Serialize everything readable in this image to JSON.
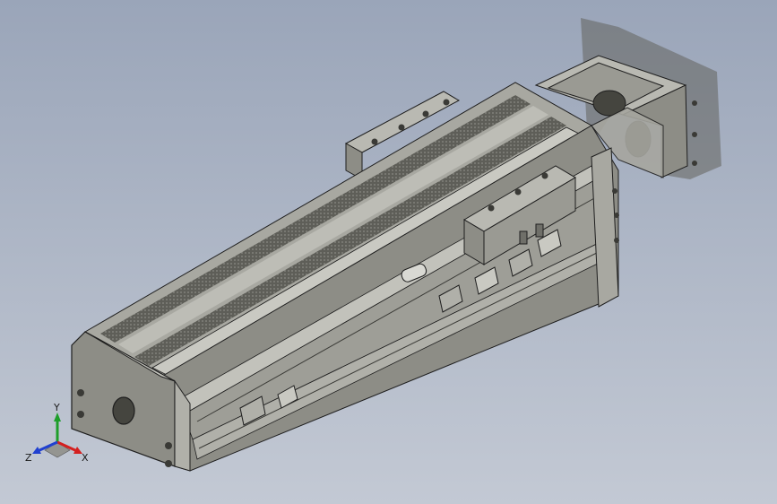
{
  "viewport": {
    "background_top": "#9aa5b9",
    "background_bottom": "#c3c9d4",
    "model_color": "#9a9a93",
    "model_dark": "#6f6f69",
    "model_light": "#b9b9b2",
    "edge_color": "#1e1e1e"
  },
  "model": {
    "name": "linear-actuator-module",
    "icons": [
      "motor-bracket-icon",
      "carriage-icon",
      "sensor-icon",
      "end-cap-icon"
    ]
  },
  "triad": {
    "x_label": "X",
    "y_label": "Y",
    "z_label": "Z",
    "x_color": "#d42020",
    "y_color": "#1e9e2a",
    "z_color": "#2040d0"
  }
}
